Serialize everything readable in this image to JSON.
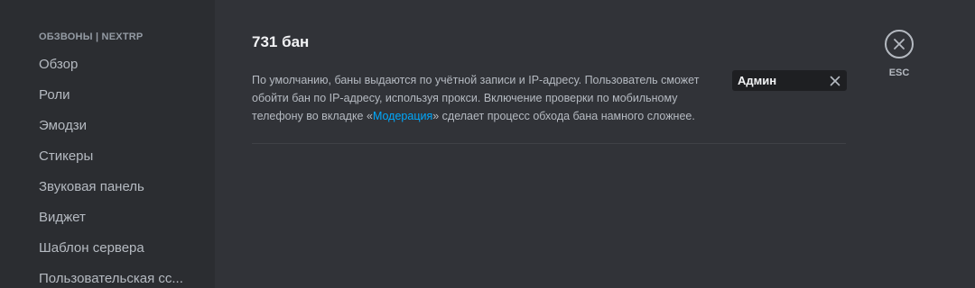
{
  "sidebar": {
    "header": "ОБЗВОНЫ | NEXTRP",
    "items": [
      {
        "label": "Обзор"
      },
      {
        "label": "Роли"
      },
      {
        "label": "Эмодзи"
      },
      {
        "label": "Стикеры"
      },
      {
        "label": "Звуковая панель"
      },
      {
        "label": "Виджет"
      },
      {
        "label": "Шаблон сервера"
      },
      {
        "label": "Пользовательская сс..."
      }
    ]
  },
  "main": {
    "title": "731 бан",
    "description_before": "По умолчанию, баны выдаются по учётной записи и IP-адресу. Пользователь сможет обойти бан по IP-адресу, используя прокси. Включение проверки по мобильному телефону во вкладке «",
    "description_link": "Модерация",
    "description_after": "» сделает процесс обхода бана намного сложнее."
  },
  "search": {
    "value": "Админ",
    "clear_icon": "close-icon"
  },
  "close": {
    "icon": "close-icon",
    "label": "ESC"
  },
  "colors": {
    "background": "#313338",
    "sidebar": "#2b2d31",
    "link": "#00a8fc",
    "text_primary": "#f2f3f5",
    "text_secondary": "#b5bac1"
  }
}
